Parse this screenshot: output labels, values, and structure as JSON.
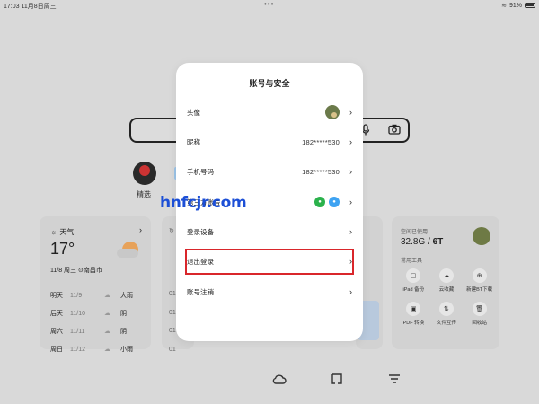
{
  "status": {
    "time": "17:03",
    "date": "11月8日周三",
    "battery": "91%"
  },
  "shortcut": {
    "label": "精选"
  },
  "weather": {
    "title": "天气",
    "temp": "17°",
    "date_loc": "11/8 周三",
    "location": "南昌市",
    "rows": [
      {
        "day": "明天",
        "date": "11/9",
        "cond": "大雨"
      },
      {
        "day": "后天",
        "date": "11/10",
        "cond": "阴"
      },
      {
        "day": "周六",
        "date": "11/11",
        "cond": "阴"
      },
      {
        "day": "周日",
        "date": "11/12",
        "cond": "小雨"
      }
    ]
  },
  "mid_card": {
    "items": [
      "01",
      "01",
      "01",
      "01"
    ]
  },
  "storage": {
    "label": "空间已使用",
    "used": "32.8G",
    "sep": " / ",
    "total": "6T",
    "tools_label": "常用工具",
    "tools": [
      {
        "icon": "ipad-backup-icon",
        "glyph": "▢",
        "label": "iPad 备份"
      },
      {
        "icon": "cloud-collect-icon",
        "glyph": "☁",
        "label": "云收藏"
      },
      {
        "icon": "bt-download-icon",
        "glyph": "⊕",
        "label": "新建BT下载"
      },
      {
        "icon": "pdf-convert-icon",
        "glyph": "▣",
        "label": "PDF 转换"
      },
      {
        "icon": "file-transfer-icon",
        "glyph": "⇅",
        "label": "文件互传"
      },
      {
        "icon": "recycle-bin-icon",
        "glyph": "🗑",
        "label": "回收站"
      }
    ]
  },
  "modal": {
    "title": "账号与安全",
    "rows": [
      {
        "label": "头像",
        "value": ""
      },
      {
        "label": "昵称",
        "value": "182*****530"
      },
      {
        "label": "手机号码",
        "value": "182*****530"
      },
      {
        "label": "第三方账号",
        "value": ""
      },
      {
        "label": "登录设备",
        "value": ""
      },
      {
        "label": "退出登录",
        "value": ""
      },
      {
        "label": "账号注销",
        "value": ""
      }
    ]
  },
  "watermark": "hnfcjr.com",
  "colors": {
    "highlight": "#d9262b",
    "wechat": "#2bb24c",
    "qq": "#3ea3f2"
  }
}
